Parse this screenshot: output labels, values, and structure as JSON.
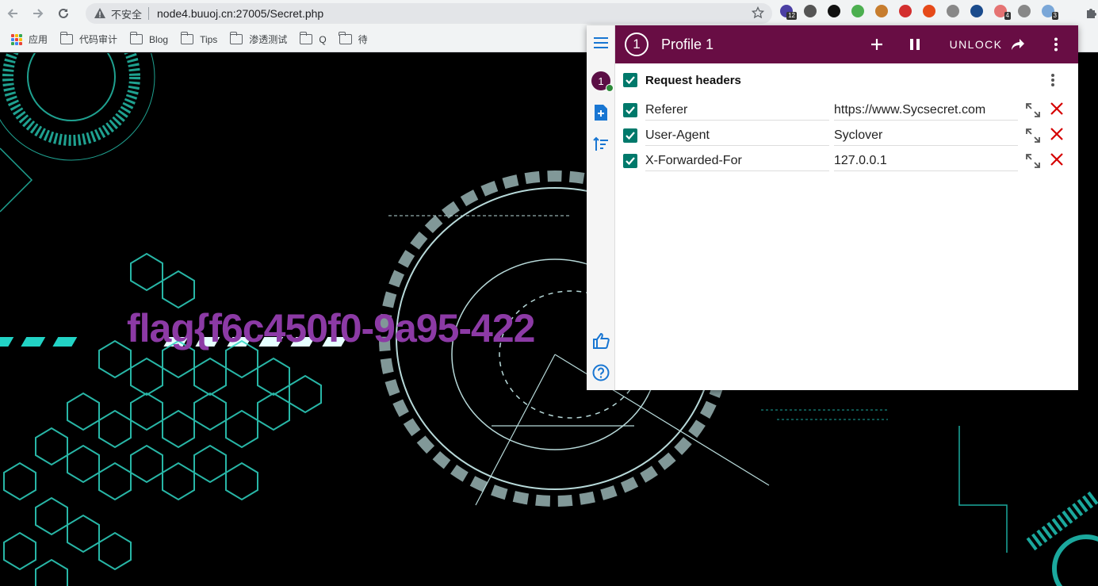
{
  "browser": {
    "security_label": "不安全",
    "url": "node4.buuoj.cn:27005/Secret.php",
    "extensions": [
      {
        "icon": "graduation-cap-icon",
        "color": "#4b3fa3",
        "badge": "12"
      },
      {
        "icon": "gear-icon",
        "color": "#555555",
        "badge": ""
      },
      {
        "icon": "h-icon",
        "color": "#111111",
        "badge": ""
      },
      {
        "icon": "cursor-icon",
        "color": "#4caf50",
        "badge": ""
      },
      {
        "icon": "cookie-icon",
        "color": "#c77d2e",
        "badge": ""
      },
      {
        "icon": "play-icon",
        "color": "#d32f2f",
        "badge": ""
      },
      {
        "icon": "network-icon",
        "color": "#e64a19",
        "badge": ""
      },
      {
        "icon": "globe-icon",
        "color": "#888888",
        "badge": ""
      },
      {
        "icon": "compass-icon",
        "color": "#1a4b8c",
        "badge": ""
      },
      {
        "icon": "link-icon",
        "color": "#e57373",
        "badge": "4"
      },
      {
        "icon": "arrow-icon",
        "color": "#888888",
        "badge": ""
      },
      {
        "icon": "modheader-icon",
        "color": "#7aa7d8",
        "badge": "3"
      }
    ]
  },
  "bookmarks": [
    {
      "label": "应用",
      "icon": "apps-icon"
    },
    {
      "label": "代码审计",
      "icon": "folder-icon"
    },
    {
      "label": "Blog",
      "icon": "folder-icon"
    },
    {
      "label": "Tips",
      "icon": "folder-icon"
    },
    {
      "label": "渗透测试",
      "icon": "folder-icon"
    },
    {
      "label": "Q",
      "icon": "folder-icon"
    },
    {
      "label": "待",
      "icon": "folder-icon"
    }
  ],
  "page": {
    "flag_text": "flag{f6c450f0-9a95-422"
  },
  "modheader": {
    "profile_number": "1",
    "profile_name": "Profile 1",
    "unlock_label": "UNLOCK",
    "section_title": "Request headers",
    "headers": [
      {
        "name": "Referer",
        "value": "https://www.Sycsecret.com",
        "enabled": true
      },
      {
        "name": "User-Agent",
        "value": "Syclover",
        "enabled": true
      },
      {
        "name": "X-Forwarded-For",
        "value": "127.0.0.1",
        "enabled": true
      }
    ],
    "accent": "#680d44",
    "checkbox_color": "#00796b",
    "delete_color": "#d50000"
  }
}
